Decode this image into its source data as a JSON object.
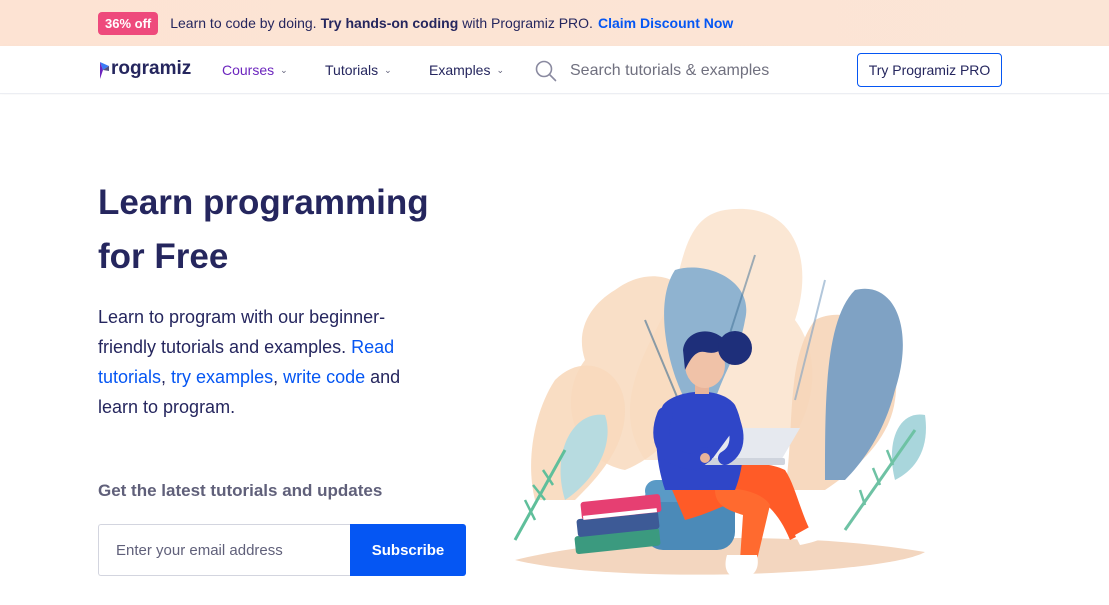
{
  "promo": {
    "badge": "36% off",
    "text1": "Learn to code by doing.",
    "bold": "Try hands-on coding",
    "text2": "with Programiz PRO.",
    "link": "Claim Discount Now"
  },
  "nav": {
    "logo": "rogramiz",
    "menu": [
      {
        "label": "Courses",
        "active": true
      },
      {
        "label": "Tutorials",
        "active": false
      },
      {
        "label": "Examples",
        "active": false
      }
    ],
    "search_placeholder": "Search tutorials & examples",
    "pro_button": "Try Programiz PRO"
  },
  "hero": {
    "headline_line1": "Learn programming",
    "headline_line2": "for Free",
    "desc_text1": "Learn to program with our beginner-friendly tutorials and examples. ",
    "link_read": "Read tutorials",
    "sep1": ", ",
    "link_try": "try examples",
    "sep2": ", ",
    "link_write": "write code",
    "desc_text2": " and learn to program."
  },
  "newsletter": {
    "title": "Get the latest tutorials and updates",
    "email_placeholder": "Enter your email address",
    "subscribe_label": "Subscribe"
  },
  "colors": {
    "primary_blue": "#0556f3",
    "navy": "#25265e",
    "purple": "#6c25be",
    "badge_pink": "#ee4a7c",
    "banner_bg": "#fde3d3"
  },
  "icons": {
    "search": "search-icon",
    "chevron": "chevron-down-icon",
    "logo": "programiz-logo-icon"
  }
}
